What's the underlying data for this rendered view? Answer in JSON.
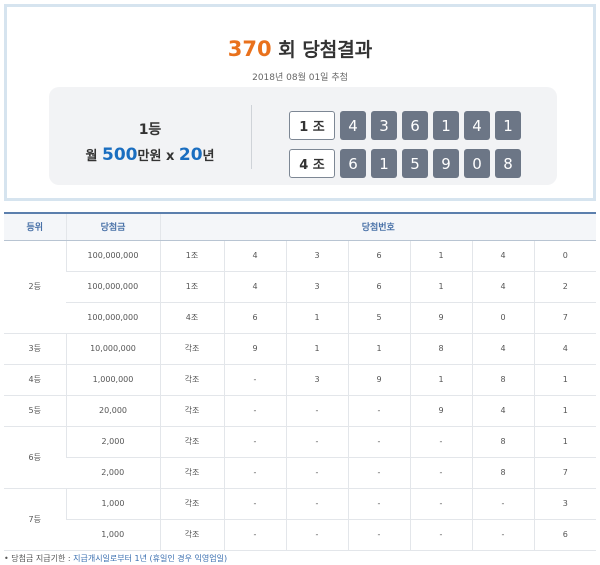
{
  "header": {
    "round_number": "370",
    "round_suffix": "회 당첨결과",
    "draw_date": "2018년 08월 01일 추첨"
  },
  "first_prize": {
    "rank_label": "1등",
    "prize_prefix": "월 ",
    "amount": "500",
    "amount_unit": "만원 x ",
    "years": "20",
    "years_unit": "년",
    "rows": [
      {
        "group": "1 조",
        "digits": [
          "4",
          "3",
          "6",
          "1",
          "4",
          "1"
        ]
      },
      {
        "group": "4 조",
        "digits": [
          "6",
          "1",
          "5",
          "9",
          "0",
          "8"
        ]
      }
    ]
  },
  "table": {
    "headers": {
      "rank": "등위",
      "prize": "당첨금",
      "numbers": "당첨번호"
    },
    "ranks": [
      {
        "label": "2등",
        "rows": [
          {
            "prize": "100,000,000",
            "group": "1조",
            "digits": [
              "4",
              "3",
              "6",
              "1",
              "4",
              "0"
            ]
          },
          {
            "prize": "100,000,000",
            "group": "1조",
            "digits": [
              "4",
              "3",
              "6",
              "1",
              "4",
              "2"
            ]
          },
          {
            "prize": "100,000,000",
            "group": "4조",
            "digits": [
              "6",
              "1",
              "5",
              "9",
              "0",
              "7"
            ]
          }
        ]
      },
      {
        "label": "3등",
        "rows": [
          {
            "prize": "10,000,000",
            "group": "각조",
            "digits": [
              "9",
              "1",
              "1",
              "8",
              "4",
              "4"
            ]
          }
        ]
      },
      {
        "label": "4등",
        "rows": [
          {
            "prize": "1,000,000",
            "group": "각조",
            "digits": [
              "-",
              "3",
              "9",
              "1",
              "8",
              "1"
            ]
          }
        ]
      },
      {
        "label": "5등",
        "rows": [
          {
            "prize": "20,000",
            "group": "각조",
            "digits": [
              "-",
              "-",
              "-",
              "9",
              "4",
              "1"
            ]
          }
        ]
      },
      {
        "label": "6등",
        "rows": [
          {
            "prize": "2,000",
            "group": "각조",
            "digits": [
              "-",
              "-",
              "-",
              "-",
              "8",
              "1"
            ]
          },
          {
            "prize": "2,000",
            "group": "각조",
            "digits": [
              "-",
              "-",
              "-",
              "-",
              "8",
              "7"
            ]
          }
        ]
      },
      {
        "label": "7등",
        "rows": [
          {
            "prize": "1,000",
            "group": "각조",
            "digits": [
              "-",
              "-",
              "-",
              "-",
              "-",
              "3"
            ]
          },
          {
            "prize": "1,000",
            "group": "각조",
            "digits": [
              "-",
              "-",
              "-",
              "-",
              "-",
              "6"
            ]
          }
        ]
      }
    ]
  },
  "footnote": {
    "label": "• 당첨금 지급기한 : ",
    "value": "지급개시일로부터 1년 (휴일인 경우 익영업일)"
  },
  "colors": {
    "round_accent": "#e9711c",
    "amount_accent": "#1a6ec0",
    "ball_fill": "#6c7686",
    "header_text": "#4a72a8"
  }
}
